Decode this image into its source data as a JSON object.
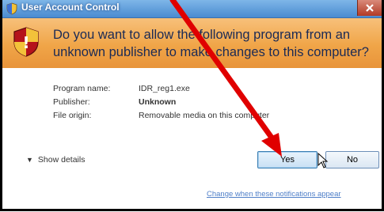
{
  "window": {
    "title": "User Account Control"
  },
  "banner": {
    "question": "Do you want to allow the following program from an unknown publisher to make changes to this computer?"
  },
  "fields": {
    "program_label": "Program name:",
    "program_value": "IDR_reg1.exe",
    "publisher_label": "Publisher:",
    "publisher_value": "Unknown",
    "origin_label": "File origin:",
    "origin_value": "Removable media on this computer"
  },
  "details": {
    "label": "Show details"
  },
  "buttons": {
    "yes_label": "Yes",
    "no_label": "No"
  },
  "link": {
    "label": "Change when these notifications appear"
  },
  "colors": {
    "banner_orange": "#f0a548",
    "annotation_red": "#e00000",
    "link_blue": "#4f7fc8"
  },
  "icons": [
    "uac-shield-icon",
    "warning-shield-icon",
    "close-icon",
    "chevron-down-icon",
    "mouse-cursor-icon",
    "annotation-arrow"
  ]
}
